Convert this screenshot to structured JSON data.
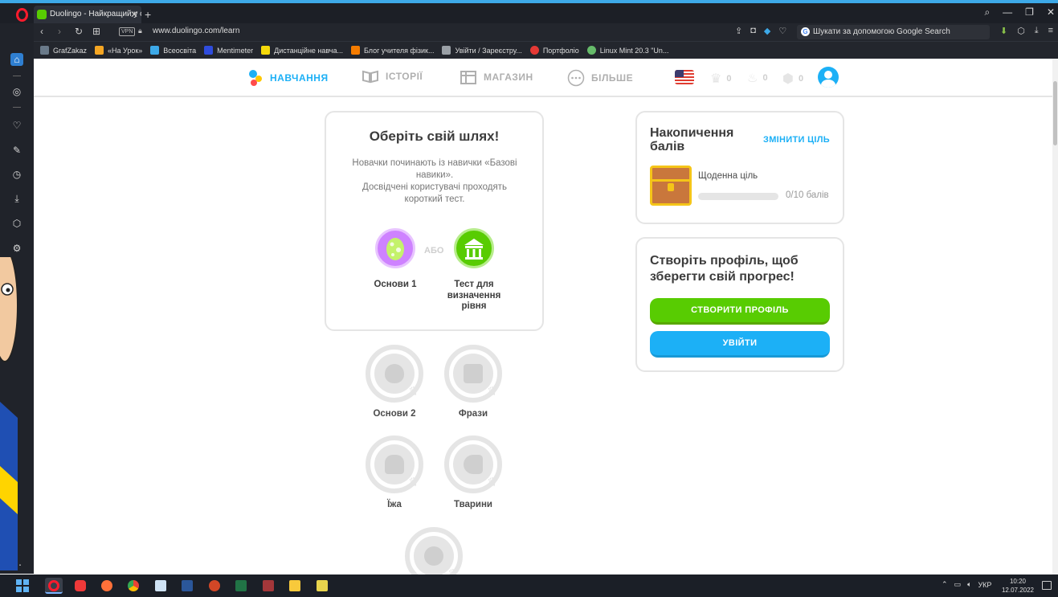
{
  "browser": {
    "tab_title": "Duolingo - Найкращий у с",
    "tab_close": "✕",
    "new_tab": "+",
    "url": "www.duolingo.com/learn",
    "vpn_label": "VPN",
    "search_placeholder": "Шукати за допомогою Google Search",
    "bookmarks": [
      {
        "label": "GrafZakaz",
        "color": "#6a7a8a"
      },
      {
        "label": "«На Урок»",
        "color": "#f5a623"
      },
      {
        "label": "Всеосвіта",
        "color": "#3da9e8"
      },
      {
        "label": "Mentimeter",
        "color": "#2f4cdd"
      },
      {
        "label": "Дистанційне навча...",
        "color": "#f5d90a"
      },
      {
        "label": "Блог учителя фізик...",
        "color": "#f57c00"
      },
      {
        "label": "Увійти / Зареєстру...",
        "color": "#9aa0a6"
      },
      {
        "label": "Портфоліо",
        "color": "#e53935"
      },
      {
        "label": "Linux Mint 20.3 \"Un...",
        "color": "#66bb6a"
      }
    ]
  },
  "nav": {
    "learn": "НАВЧАННЯ",
    "stories": "ІСТОРІЇ",
    "shop": "МАГАЗИН",
    "more": "БІЛЬШЕ",
    "crowns": "0",
    "streak": "0",
    "gems": "0"
  },
  "path_card": {
    "title": "Оберіть свій шлях!",
    "desc_line1": "Новачки починають із навички «Базові навики».",
    "desc_line2": "Досвідчені користувачі проходять короткий тест.",
    "or": "АБО",
    "option1": "Основи 1",
    "option2": "Тест для визначення рівня"
  },
  "skills": [
    {
      "label": "Основи 2"
    },
    {
      "label": "Фрази"
    },
    {
      "label": "Їжа"
    },
    {
      "label": "Тварини"
    }
  ],
  "xp_card": {
    "title": "Накопичення балів",
    "change_goal": "ЗМІНИТИ ЦІЛЬ",
    "daily_goal": "Щоденна ціль",
    "progress_text": "0/10 балів",
    "progress_fraction": 0.0
  },
  "profile_card": {
    "title": "Створіть профіль, щоб зберегти свій прогрес!",
    "create_button": "СТВОРИТИ ПРОФІЛЬ",
    "login_button": "УВІЙТИ"
  },
  "taskbar": {
    "language": "УКР",
    "time": "10:20",
    "date": "12.07.2022"
  },
  "colors": {
    "accent_blue": "#1cb0f6",
    "duo_green": "#58cc02",
    "egg_purple": "#ce82ff"
  }
}
